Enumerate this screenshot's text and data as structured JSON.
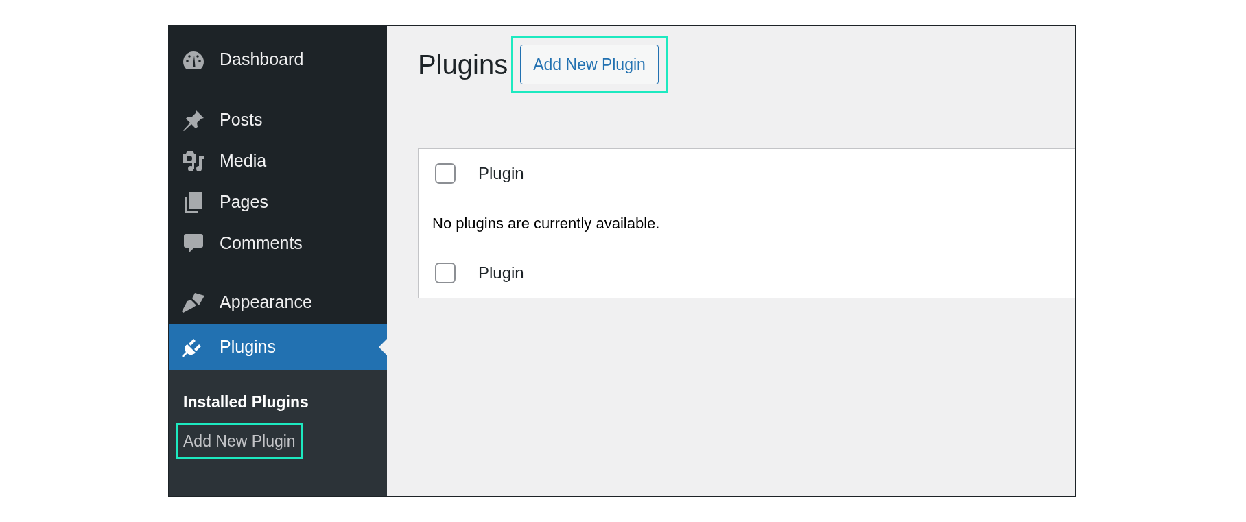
{
  "sidebar": {
    "items": [
      {
        "label": "Dashboard",
        "kind": "gauge",
        "selected": false
      },
      {
        "label": "Posts",
        "kind": "pin",
        "selected": false
      },
      {
        "label": "Media",
        "kind": "media",
        "selected": false
      },
      {
        "label": "Pages",
        "kind": "pages",
        "selected": false
      },
      {
        "label": "Comments",
        "kind": "comment",
        "selected": false
      },
      {
        "label": "Appearance",
        "kind": "brush",
        "selected": false
      },
      {
        "label": "Plugins",
        "kind": "plug",
        "selected": true
      }
    ],
    "submenu": [
      {
        "label": "Installed Plugins",
        "selected": true,
        "highlighted": false
      },
      {
        "label": "Add New Plugin",
        "selected": false,
        "highlighted": true
      }
    ]
  },
  "page": {
    "title": "Plugins",
    "action": {
      "label": "Add New Plugin",
      "highlighted": true
    }
  },
  "table": {
    "header": {
      "label": "Plugin",
      "checked": false
    },
    "message": "No plugins are currently available.",
    "footer": {
      "label": "Plugin",
      "checked": false
    }
  }
}
